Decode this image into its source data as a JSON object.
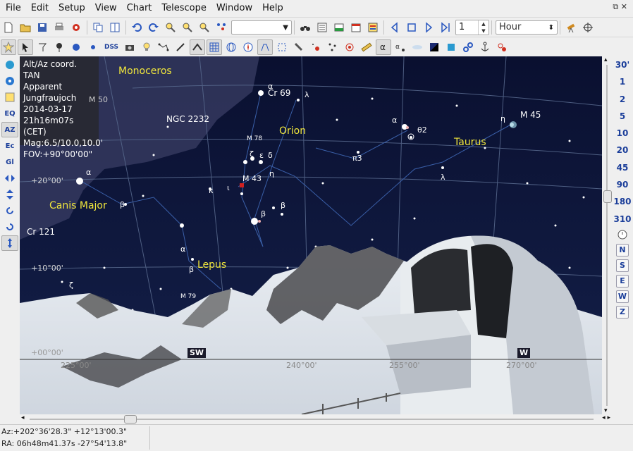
{
  "menu": {
    "items": [
      "File",
      "Edit",
      "Setup",
      "View",
      "Chart",
      "Telescope",
      "Window",
      "Help"
    ]
  },
  "toolbar1": {
    "timestep_value": "1",
    "timeunit_value": "Hour",
    "search_value": ""
  },
  "toolbar2": {
    "dss_label": "DSS"
  },
  "left_toolbar": {
    "eq_label": "EQ",
    "az_label": "AZ",
    "ec_label": "Ec",
    "gl_label": "Gl"
  },
  "right_toolbar": {
    "fov_items": [
      "30'",
      "1",
      "2",
      "5",
      "10",
      "20",
      "45",
      "90",
      "180",
      "310"
    ],
    "directions": [
      "N",
      "S",
      "E",
      "W",
      "Z"
    ]
  },
  "infobox": {
    "lines": [
      "Alt/Az coord. TAN",
      "Apparent",
      "Jungfraujoch",
      "2014-03-17",
      "21h16m07s (CET)",
      "Mag:6.5/10.0,10.0'",
      "FOV:+90°00'00\""
    ]
  },
  "sky": {
    "constellations": [
      "Monoceros",
      "Orion",
      "Taurus",
      "Canis Major",
      "Lepus"
    ],
    "objects": [
      "Cr 69",
      "M 50",
      "NGC 2232",
      "M 78",
      "M 43",
      "M 45",
      "Cr 121",
      "M 79"
    ],
    "star_labels": [
      "α",
      "λ",
      "α",
      "θ2",
      "η",
      "ζ",
      "ε",
      "δ",
      "η",
      "π3",
      "ι",
      "κ",
      "β",
      "β",
      "λ",
      "α",
      "β",
      "α",
      "β",
      "ζ"
    ],
    "altitude_labels": [
      "+20°00'",
      "+10°00'",
      "+00°00'"
    ],
    "azimuth_labels": [
      "225°00'",
      "240°00'",
      "255°00'",
      "270°00'"
    ],
    "cardinals": [
      "SW",
      "W"
    ]
  },
  "status": {
    "altaz": "Az:+202°36'28.3\" +12°13'00.3\"",
    "radec": "RA: 06h48m41.37s -27°54'13.8\""
  },
  "colors": {
    "sky": "#0a1030",
    "constellation_label": "#f0e63c",
    "button_text": "#1b3e9a"
  }
}
